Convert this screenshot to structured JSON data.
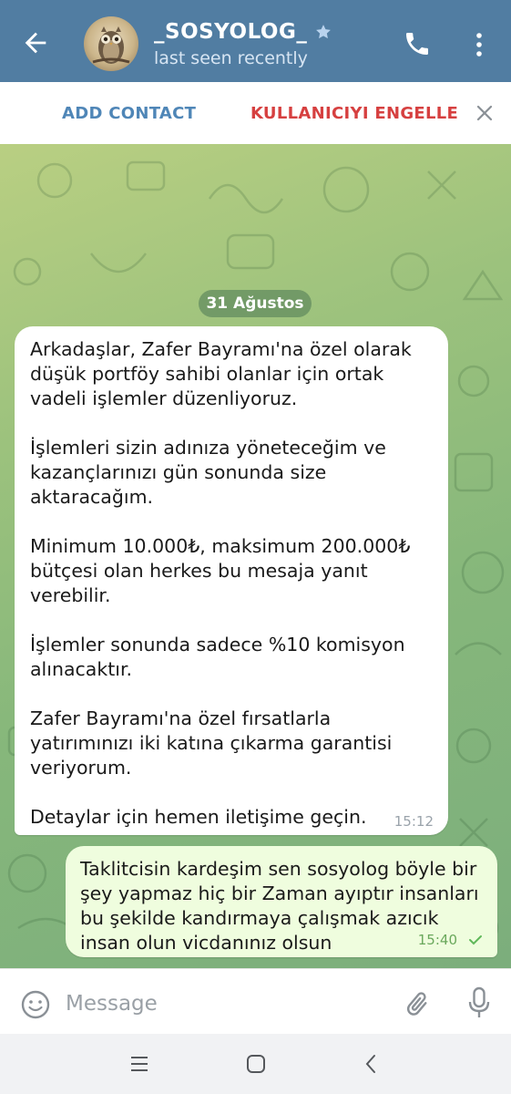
{
  "header": {
    "contact_name": "_SOSYOLOG_",
    "status": "last seen recently",
    "icons": {
      "back": "arrow-left-icon",
      "verified": "star-icon",
      "call": "phone-icon",
      "more": "more-vertical-icon"
    },
    "color": "#517da2"
  },
  "action_bar": {
    "add_contact": "ADD CONTACT",
    "block_user": "KULLANICIYI ENGELLE",
    "close_icon": "close-icon"
  },
  "chat": {
    "date_chip": "31 Ağustos",
    "incoming": {
      "paragraphs": [
        "Arkadaşlar, Zafer Bayramı'na özel olarak düşük portföy sahibi olanlar için ortak vadeli işlemler düzenliyoruz.",
        "İşlemleri sizin adınıza yöneteceğim ve kazançlarınızı gün sonunda size aktaracağım.",
        "Minimum 10.000₺, maksimum 200.000₺ bütçesi olan herkes bu mesaja yanıt verebilir.",
        "İşlemler sonunda sadece %10 komisyon alınacaktır.",
        "Zafer Bayramı'na özel fırsatlarla yatırımınızı iki katına çıkarma garantisi veriyorum.",
        "Detaylar için hemen iletişime geçin."
      ],
      "time": "15:12"
    },
    "outgoing": {
      "text": "Taklitcisin kardeşim sen sosyolog böyle bir şey yapmaz hiç bir Zaman ayıptır insanları bu şekilde kandırmaya çalışmak azıcık insan olun vicdanınız olsun",
      "time": "15:40",
      "status_icon": "double-check-icon"
    }
  },
  "input_bar": {
    "placeholder": "Message",
    "value": "",
    "icons": {
      "emoji": "emoji-icon",
      "attach": "paperclip-icon",
      "mic": "microphone-icon"
    }
  },
  "nav_bar": {
    "icons": [
      "recent-apps-icon",
      "home-icon",
      "back-icon"
    ]
  }
}
